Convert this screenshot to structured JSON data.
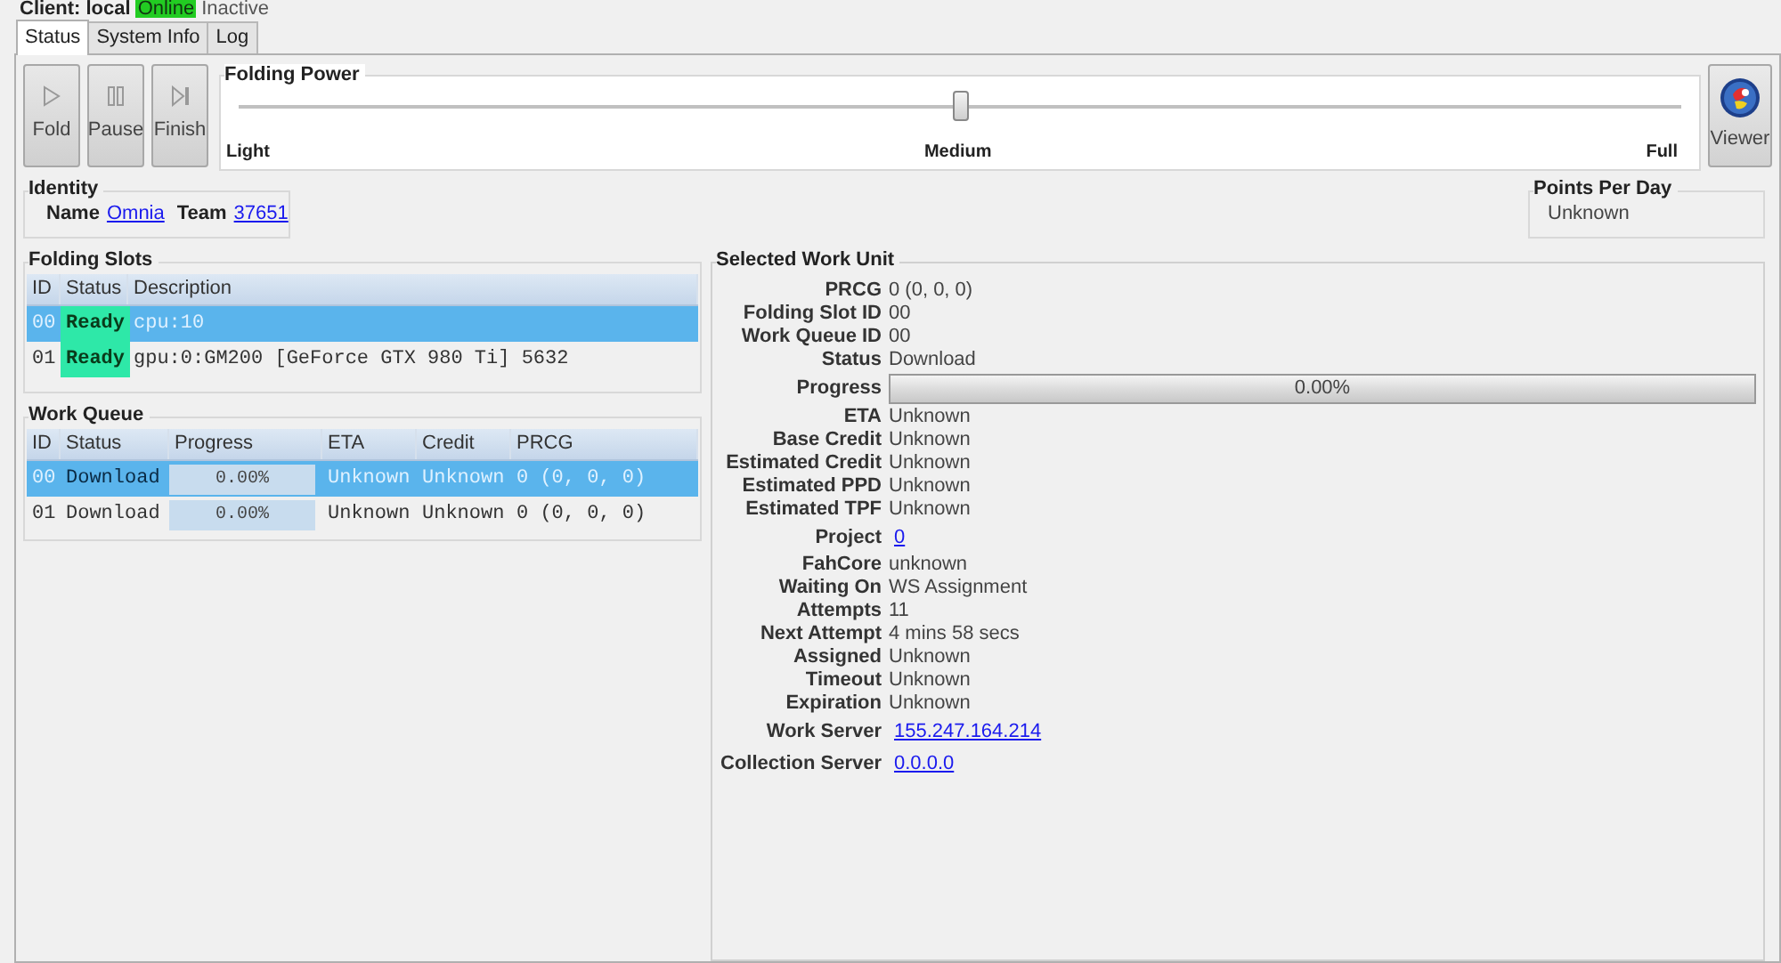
{
  "client": {
    "label": "Client:",
    "name": "local",
    "states": [
      {
        "label": "Online",
        "highlighted": true
      },
      {
        "label": "Inactive",
        "highlighted": false
      }
    ]
  },
  "tabs": [
    {
      "label": "Status",
      "selected": true
    },
    {
      "label": "System Info",
      "selected": false
    },
    {
      "label": "Log",
      "selected": false
    }
  ],
  "buttons": [
    {
      "kind": "play",
      "label": "Fold"
    },
    {
      "kind": "pause",
      "label": "Pause"
    },
    {
      "kind": "finish",
      "label": "Finish"
    }
  ],
  "folding_power": {
    "title": "Folding Power",
    "level": 0.5,
    "labels": [
      "Light",
      "Medium",
      "Full"
    ]
  },
  "viewer_button": {
    "label": "Viewer"
  },
  "identity": {
    "title": "Identity",
    "name_label": "Name",
    "name": "Omnia",
    "team_label": "Team",
    "team": "37651"
  },
  "points_per_day": {
    "title": "Points Per Day",
    "value": "Unknown"
  },
  "folding_slots": {
    "title": "Folding Slots",
    "columns": [
      "ID",
      "Status",
      "Description"
    ],
    "rows": [
      {
        "id": "00",
        "status": "Ready",
        "description": "cpu:10",
        "selected": true
      },
      {
        "id": "01",
        "status": "Ready",
        "description": "gpu:0:GM200 [GeForce GTX 980 Ti] 5632",
        "selected": false
      }
    ]
  },
  "work_queue": {
    "title": "Work Queue",
    "columns": [
      "ID",
      "Status",
      "Progress",
      "ETA",
      "Credit",
      "PRCG"
    ],
    "rows": [
      {
        "id": "00",
        "status": "Download",
        "progress": "0.00%",
        "level": 0,
        "eta": "Unknown",
        "credit": "Unknown",
        "prcg": "0 (0, 0, 0)",
        "selected": true
      },
      {
        "id": "01",
        "status": "Download",
        "progress": "0.00%",
        "level": 0,
        "eta": "Unknown",
        "credit": "Unknown",
        "prcg": "0 (0, 0, 0)",
        "selected": false
      }
    ]
  },
  "selected_work_unit": {
    "title": "Selected Work Unit",
    "fields": [
      {
        "kind": "text",
        "label": "PRCG",
        "value": "0 (0, 0, 0)"
      },
      {
        "kind": "text",
        "label": "Folding Slot ID",
        "value": "00"
      },
      {
        "kind": "text",
        "label": "Work Queue ID",
        "value": "00"
      },
      {
        "kind": "text",
        "label": "Status",
        "value": "Download"
      },
      {
        "kind": "progress",
        "label": "Progress",
        "value": "0.00%",
        "level": 0
      },
      {
        "kind": "text",
        "label": "ETA",
        "value": "Unknown"
      },
      {
        "kind": "text",
        "label": "Base Credit",
        "value": "Unknown"
      },
      {
        "kind": "text",
        "label": "Estimated Credit",
        "value": "Unknown"
      },
      {
        "kind": "text",
        "label": "Estimated PPD",
        "value": "Unknown"
      },
      {
        "kind": "text",
        "label": "Estimated TPF",
        "value": "Unknown"
      },
      {
        "kind": "link",
        "label": "Project",
        "value": "0"
      },
      {
        "kind": "text",
        "label": "FahCore",
        "value": "unknown"
      },
      {
        "kind": "text",
        "label": "Waiting On",
        "value": "WS Assignment"
      },
      {
        "kind": "text",
        "label": "Attempts",
        "value": "11"
      },
      {
        "kind": "text",
        "label": "Next Attempt",
        "value": "4 mins 58 secs"
      },
      {
        "kind": "text",
        "label": "Assigned",
        "value": "Unknown"
      },
      {
        "kind": "text",
        "label": "Timeout",
        "value": "Unknown"
      },
      {
        "kind": "text",
        "label": "Expiration",
        "value": "Unknown"
      },
      {
        "kind": "link",
        "label": "Work Server",
        "value": "155.247.164.214"
      },
      {
        "kind": "link",
        "label": "Collection Server",
        "value": "0.0.0.0"
      }
    ]
  }
}
